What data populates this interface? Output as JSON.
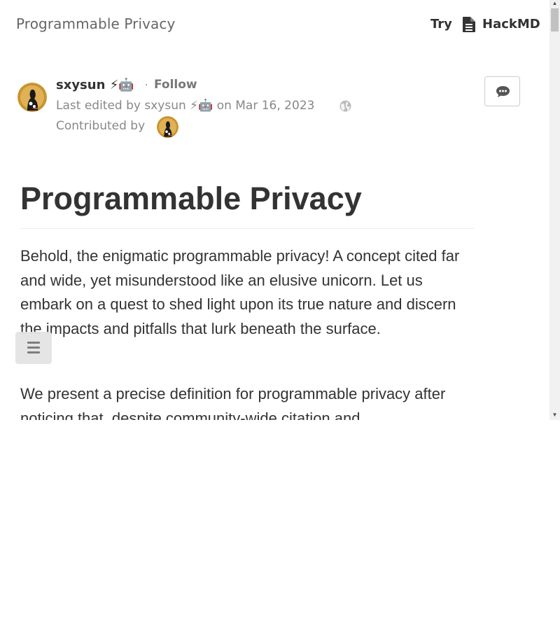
{
  "header": {
    "doc_title": "Programmable Privacy",
    "try_label": "Try",
    "hackmd_label": "HackMD",
    "hackmd_icon": "file-document-icon"
  },
  "author": {
    "name": "sxysun",
    "name_emoji": "⚡🤖",
    "separator": "·",
    "follow_label": "Follow",
    "last_edited_prefix": "Last edited by",
    "last_edited_user": "sxysun",
    "last_edited_emoji": "⚡🤖",
    "last_edited_date": "on Mar 16, 2023",
    "visibility_icon": "globe-icon",
    "contributed_label": "Contributed by"
  },
  "comment_button": {
    "icon": "comment-icon"
  },
  "article": {
    "title": "Programmable Privacy",
    "paragraphs": [
      "Behold, the enigmatic programmable privacy! A concept cited far and wide, yet misunderstood like an elusive unicorn. Let us embark on a quest to shed light upon its true nature and discern the impacts and pitfalls that lurk beneath the surface.",
      "We present a precise definition for programmable privacy after noticing that, despite community-wide citation and"
    ]
  },
  "toc_button": {
    "icon": "list-icon"
  },
  "colors": {
    "text_primary": "#333333",
    "text_muted": "#888888",
    "title_gray": "#666666",
    "rule": "#eeeeee",
    "toc_bg": "#e4e4e4"
  }
}
